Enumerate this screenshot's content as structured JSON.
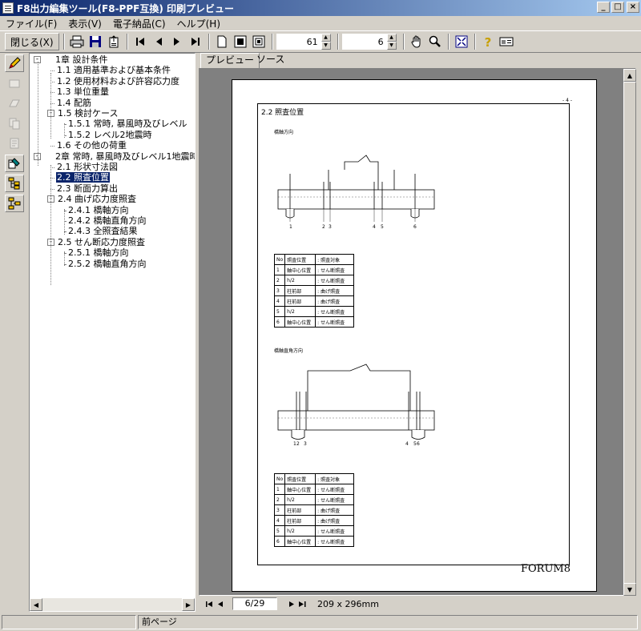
{
  "window": {
    "title": "F8出力編集ツール(F8-PPF互換) 印刷プレビュー"
  },
  "menu": [
    "ファイル(F)",
    "表示(V)",
    "電子納品(C)",
    "ヘルプ(H)"
  ],
  "toolbar": {
    "close_label": "閉じる(X)",
    "zoom_value": "61",
    "pages_value": "6"
  },
  "tree": {
    "items": [
      {
        "label": "1章 設計条件"
      },
      {
        "label": "1.1 適用基準および基本条件"
      },
      {
        "label": "1.2 使用材料および許容応力度"
      },
      {
        "label": "1.3 単位重量"
      },
      {
        "label": "1.4 配筋"
      },
      {
        "label": "1.5 検討ケース"
      },
      {
        "label": "1.5.1 常時, 暴風時及びレベル"
      },
      {
        "label": "1.5.2 レベル2地震時"
      },
      {
        "label": "1.6 その他の荷重"
      },
      {
        "label": "2章 常時, 暴風時及びレベル1地震時"
      },
      {
        "label": "2.1 形状寸法図"
      },
      {
        "label": "2.2 照査位置"
      },
      {
        "label": "2.3 断面力算出"
      },
      {
        "label": "2.4 曲げ応力度照査"
      },
      {
        "label": "2.4.1 橋軸方向"
      },
      {
        "label": "2.4.2 橋軸直角方向"
      },
      {
        "label": "2.4.3 全照査結果"
      },
      {
        "label": "2.5 せん断応力度照査"
      },
      {
        "label": "2.5.1 橋軸方向"
      },
      {
        "label": "2.5.2 橋軸直角方向"
      }
    ]
  },
  "tabs": [
    "プレビュー",
    "ソース"
  ],
  "page": {
    "number": "- 4 -",
    "section": "2.2 照査位置",
    "caption1": "橋軸方向",
    "caption2": "橋軸直角方向",
    "footer": "FORUM8",
    "dim_labels_1": [
      "1",
      "2",
      "3",
      "4",
      "5",
      "6"
    ],
    "dim_labels_2": [
      "1",
      "2",
      "3",
      "4",
      "5",
      "6"
    ],
    "table_header": [
      "No",
      "照査位置",
      ": 照査対象"
    ],
    "table1": [
      [
        "1",
        "軸中心位置",
        ": せん断照査"
      ],
      [
        "2",
        "h/2",
        ": せん断照査"
      ],
      [
        "3",
        "柱前部",
        ": 曲げ照査"
      ],
      [
        "4",
        "柱前部",
        ": 曲げ照査"
      ],
      [
        "5",
        "h/2",
        ": せん断照査"
      ],
      [
        "6",
        "軸中心位置",
        ": せん断照査"
      ]
    ],
    "table2": [
      [
        "1",
        "軸中心位置",
        ": せん断照査"
      ],
      [
        "2",
        "h/2",
        ": せん断照査"
      ],
      [
        "3",
        "柱前部",
        ": 曲げ照査"
      ],
      [
        "4",
        "柱前部",
        ": 曲げ照査"
      ],
      [
        "5",
        "h/2",
        ": せん断照査"
      ],
      [
        "6",
        "軸中心位置",
        ": せん断照査"
      ]
    ]
  },
  "pagenav": {
    "current": "6/29",
    "paper_size": "209 x 296mm"
  },
  "status": {
    "text": "前ページ"
  }
}
